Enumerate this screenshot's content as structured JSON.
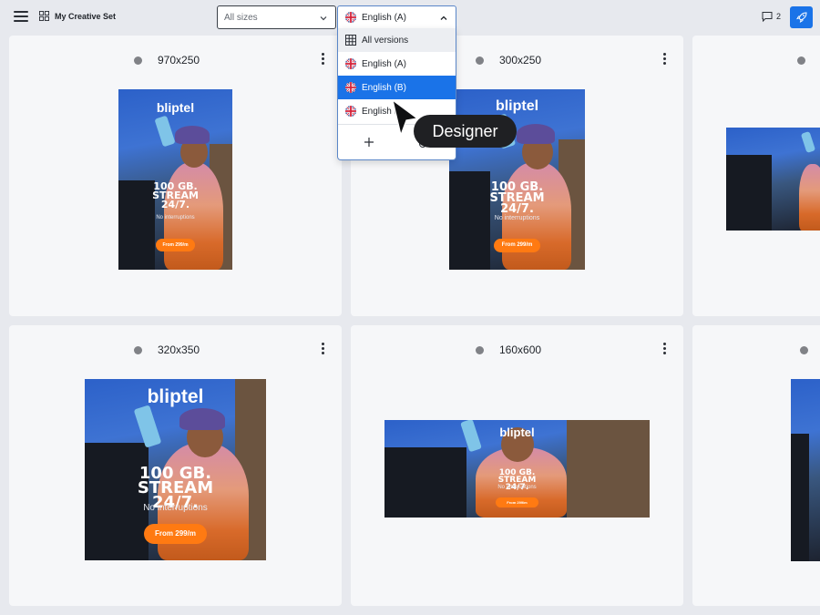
{
  "topbar": {
    "menu_icon": "hamburger-menu-icon",
    "set_icon": "grid-layout-icon",
    "set_title": "My Creative Set",
    "sizes_select": {
      "value": "All sizes"
    },
    "version_select": {
      "value": "English (A)"
    },
    "comment_count": "2",
    "comment_icon": "comment-icon",
    "launch_icon": "rocket-icon"
  },
  "dropdown": {
    "items": [
      {
        "label": "All versions",
        "icon": "grid-icon"
      },
      {
        "label": "English (A)",
        "icon": "uk-flag-icon"
      },
      {
        "label": "English (B)",
        "icon": "uk-flag-icon",
        "selected": true
      },
      {
        "label": "English (",
        "icon": "uk-flag-icon"
      }
    ],
    "add_icon": "plus-icon"
  },
  "tooltip": {
    "text": "Designer"
  },
  "cards": [
    {
      "label": "970x250"
    },
    {
      "label": "300x250"
    },
    {
      "label": ""
    },
    {
      "label": "320x350"
    },
    {
      "label": "160x600"
    },
    {
      "label": ""
    }
  ],
  "ad": {
    "logo": "bliptel",
    "headline_1": "100 GB.",
    "headline_2": "STREAM",
    "headline_3": "24/7.",
    "subline": "No interruptions",
    "cta": "From 299/m"
  },
  "colors": {
    "accent": "#1a73e8",
    "cta": "#ff7a12",
    "background": "#e7e9ee",
    "card": "#f6f7f9"
  }
}
